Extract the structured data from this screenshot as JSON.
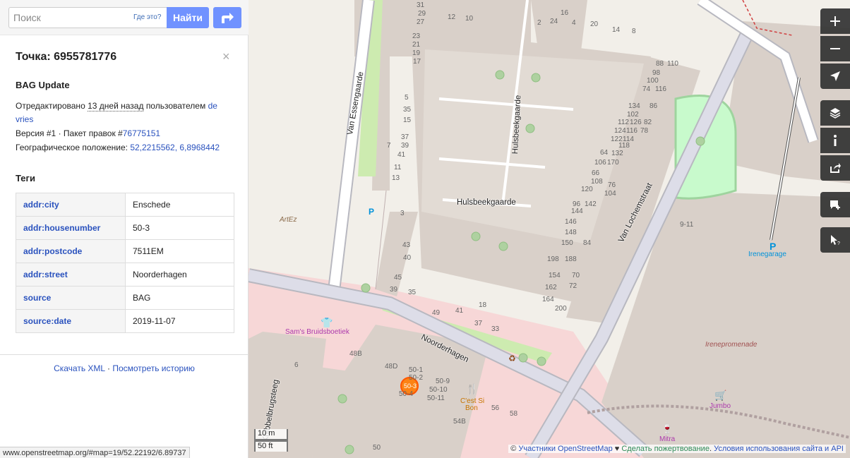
{
  "search": {
    "placeholder": "Поиск",
    "where_is_this": "Где это?",
    "go_label": "Найти"
  },
  "panel": {
    "title": "Точка: 6955781776",
    "close": "×",
    "changeset_comment": "BAG Update",
    "edited_prefix": "Отредактировано",
    "edited_time": "13 дней назад",
    "edited_by_prefix": "пользователем",
    "edited_user": "de vries",
    "version_text": "Версия #1 · Пакет правок #",
    "changeset_id": "76775151",
    "location_prefix": "Географическое положение:",
    "location": "52,2215562, 6,8968442",
    "tags_heading": "Теги",
    "tags": [
      {
        "key": "addr:city",
        "value": "Enschede"
      },
      {
        "key": "addr:housenumber",
        "value": "50-3"
      },
      {
        "key": "addr:postcode",
        "value": "7511EM"
      },
      {
        "key": "addr:street",
        "value": "Noorderhagen"
      },
      {
        "key": "source",
        "value": "BAG"
      },
      {
        "key": "source:date",
        "value": "2019-11-07"
      }
    ],
    "download_xml": "Скачать XML",
    "separator": " · ",
    "view_history": "Посмотреть историю"
  },
  "status_url": "www.openstreetmap.org/#map=19/52.22192/6.89737",
  "map": {
    "streets": {
      "van_essengaarde": "Van Essengaarde",
      "hulsbeekgaarde_vertical": "Hulsbeekgaarde",
      "hulsbeekgaarde_horizontal": "Hulsbeekgaarde",
      "van_lochemstraat": "Van Lochemstraat",
      "noorderhagen": "Noorderhagen",
      "knibbelbrugsteeg": "Knibbelbrugsteeg",
      "ireneпromenade": "Irenepromenade"
    },
    "pois": {
      "artez": "ArtEz",
      "sams": "Sam's Bruidsboetiek",
      "irenegarage": "Irenegarage",
      "cest_si_bon_1": "C'est Si",
      "cest_si_bon_2": "Bon",
      "jumbo": "Jumbo",
      "mitra": "Mitra",
      "selected_marker_label": "50-3"
    },
    "house_numbers": {
      "n31": "31",
      "n29": "29",
      "n27": "27",
      "n23": "23",
      "n21": "21",
      "n19": "19",
      "n17": "17",
      "n12": "12",
      "n10": "10",
      "n16": "16",
      "n2": "2",
      "n24": "24",
      "n4": "4",
      "n20": "20",
      "n14": "14",
      "n8": "8",
      "n5": "5",
      "n35": "35",
      "n15": "15",
      "n37": "37",
      "n7": "7",
      "n39": "39",
      "n41": "41",
      "n11": "11",
      "n13": "13",
      "n88": "88",
      "n110": "110",
      "n98": "98",
      "n100": "100",
      "n74": "74",
      "n116": "116",
      "n134": "134",
      "n86": "86",
      "n102": "102",
      "n112": "112",
      "n126": "126",
      "n82": "82",
      "n124": "124",
      "n116b": "116",
      "n78": "78",
      "n122": "122",
      "n114": "114",
      "n118": "118",
      "n64": "64",
      "n132": "132",
      "n106": "106",
      "n170": "170",
      "n66": "66",
      "n108": "108",
      "n120": "120",
      "n76": "76",
      "n104": "104",
      "n96": "96",
      "n142": "142",
      "n144": "144",
      "n146": "146",
      "n148": "148",
      "n150": "150",
      "n84": "84",
      "n198": "198",
      "n188": "188",
      "n154": "154",
      "n70": "70",
      "n162": "162",
      "n72": "72",
      "n164": "164",
      "n200": "200",
      "n3": "3",
      "n43": "43",
      "n40": "40",
      "n45": "45",
      "n39b": "39",
      "n35b": "35",
      "n49": "49",
      "n41b": "41",
      "n18": "18",
      "n37b": "37",
      "n33": "33",
      "n48b": "48B",
      "n48d": "48D",
      "n6": "6",
      "n50_1": "50-1",
      "n50_2": "50-2",
      "n50_4": "50-4",
      "n50_9": "50-9",
      "n50_10": "50-10",
      "n50_11": "50-11",
      "n56": "56",
      "n54b": "54B",
      "n58": "58",
      "n50": "50",
      "n9_11": "9-11"
    },
    "scale_m": "10 m",
    "scale_ft": "50 ft"
  },
  "attribution": {
    "copyright": "© ",
    "contributors": "Участники OpenStreetMap",
    "heart": " ♥ ",
    "donate": "Сделать пожертвование",
    "dot": ". ",
    "terms": "Условия использования сайта и API"
  }
}
